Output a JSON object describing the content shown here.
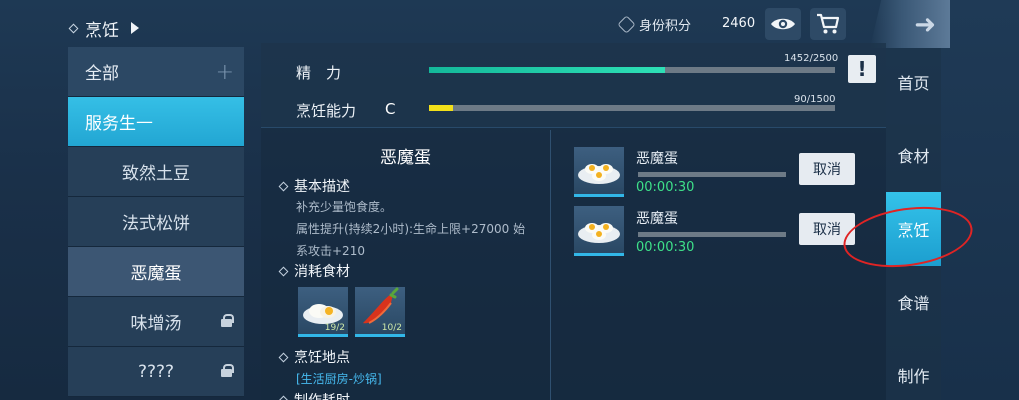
{
  "header": {
    "breadcrumb": "烹饪",
    "score_label": "身份积分",
    "score_value": "2460",
    "icons": [
      "eye-icon",
      "cart-icon",
      "back-arrow-icon"
    ]
  },
  "left_list": {
    "category_all": "全部",
    "category_all_sign": "+",
    "category_active": "服务生",
    "category_active_sign": "—",
    "items": [
      {
        "label": "致然土豆",
        "locked": false
      },
      {
        "label": "法式松饼",
        "locked": false
      },
      {
        "label": "恶魔蛋",
        "locked": false,
        "selected": true
      },
      {
        "label": "味增汤",
        "locked": true
      },
      {
        "label": "????",
        "locked": true
      }
    ]
  },
  "stats": {
    "energy_label": "精　力",
    "energy_text": "1452/2500",
    "energy_fraction": 0.5808,
    "energy_color": "#2ee0b6",
    "cooking_label": "烹饪能力",
    "cooking_grade": "C",
    "cooking_text": "90/1500",
    "cooking_fraction": 0.06,
    "cooking_color": "#f2e01a",
    "warn_button": "!"
  },
  "detail": {
    "dish_name": "恶魔蛋",
    "basic_desc_head": "基本描述",
    "desc_line1": "补充少量饱食度。",
    "desc_line2": "属性提升(持续2小时):生命上限+27000 始",
    "desc_line3": "系攻击+210",
    "ingredients_head": "消耗食材",
    "ingredients": [
      {
        "name": "egg",
        "count": "19/2"
      },
      {
        "name": "chili",
        "count": "10/2"
      }
    ],
    "location_head": "烹饪地点",
    "location": "[生活厨房-炒锅]",
    "next_head": "制作耗时"
  },
  "queue": [
    {
      "name": "恶魔蛋",
      "time": "00:00:30",
      "cancel": "取消"
    },
    {
      "name": "恶魔蛋",
      "time": "00:00:30",
      "cancel": "取消"
    }
  ],
  "right_nav": [
    "首页",
    "食材",
    "烹饪",
    "食谱",
    "制作"
  ]
}
